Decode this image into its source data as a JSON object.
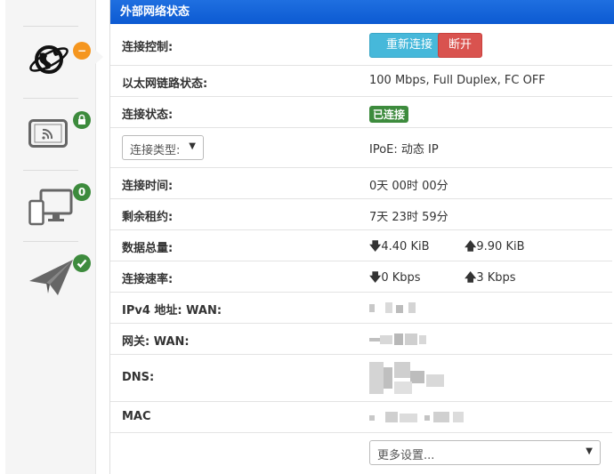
{
  "nav": {
    "items": [
      {
        "name": "internet-globe",
        "badge": "−",
        "badge_color": "#f5961f"
      },
      {
        "name": "wireless-tablet",
        "badge": "🔒",
        "badge_color": "#3d8b3d"
      },
      {
        "name": "devices",
        "badge": "0",
        "badge_color": "#3d8b3d"
      },
      {
        "name": "paper-plane",
        "badge": "✔",
        "badge_color": "#3d8b3d"
      }
    ]
  },
  "panel": {
    "title": "外部网络状态",
    "header_color": "#0f5fd6",
    "rows": {
      "control": {
        "label": "连接控制:",
        "reconnect": "重新连接",
        "disconnect": "断开"
      },
      "ethernet": {
        "label": "以太网链路状态:",
        "value": "100 Mbps, Full Duplex, FC OFF"
      },
      "conn_status": {
        "label": "连接状态:",
        "value": "已连接"
      },
      "conn_type": {
        "select": "连接类型:",
        "value": "IPoE: 动态 IP"
      },
      "conn_time": {
        "label": "连接时间:",
        "value": "0天 00时 00分"
      },
      "lease": {
        "label": "剩余租约:",
        "value": "7天 23时 59分"
      },
      "data_total": {
        "label": "数据总量:",
        "down": "4.40 KiB",
        "up": "9.90 KiB"
      },
      "speed": {
        "label": "连接速率:",
        "down": "0 Kbps",
        "up": "3 Kbps"
      },
      "ipv4": {
        "label": "IPv4 地址: WAN:"
      },
      "gateway": {
        "label": "网关: WAN:"
      },
      "dns": {
        "label": "DNS:"
      },
      "mac": {
        "label": "MAC"
      },
      "more": {
        "select": "更多设置..."
      }
    }
  },
  "icons": {
    "down": "🡇",
    "up": "🡅"
  }
}
